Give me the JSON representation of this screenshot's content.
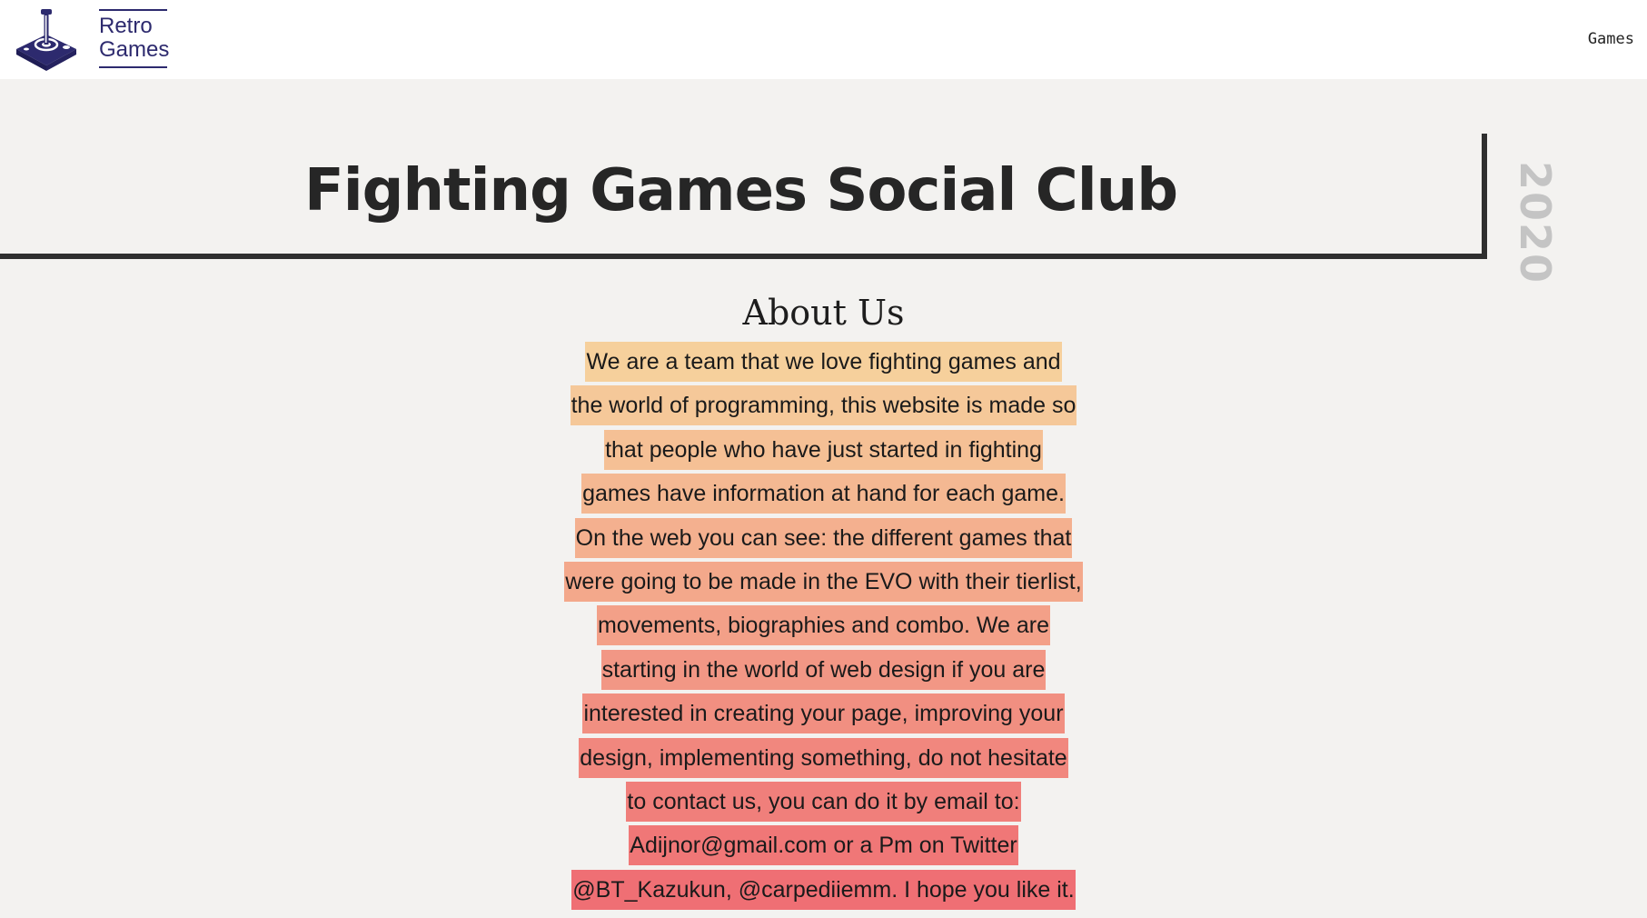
{
  "header": {
    "brand_line1": "Retro",
    "brand_line2": "Games",
    "nav_games": "Games",
    "logo_icon": "joystick-icon",
    "brand_color": "#2d2a6e"
  },
  "hero": {
    "title": "Fighting Games Social Club",
    "year": "2020"
  },
  "about": {
    "title": "About Us",
    "lines": [
      "We are a team that we love fighting games and",
      "the world of programming, this website is made so",
      "that people who have just started in fighting",
      "games have information at hand for each game.",
      "On the web you can see: the different games that",
      "were going to be made in the EVO with their tierlist,",
      "movements, biographies and combo. We are",
      "starting in the world of web design if you are",
      "interested in creating your page, improving your",
      "design, implementing something, do not hesitate",
      "to contact us, you can do it by email to:",
      "Adijnor@gmail.com or a Pm on Twitter",
      "@BT_Kazukun, @carpediiemm. I hope you like it."
    ],
    "highlight_gradient": [
      "#f6d09c",
      "#ef6f74"
    ]
  }
}
